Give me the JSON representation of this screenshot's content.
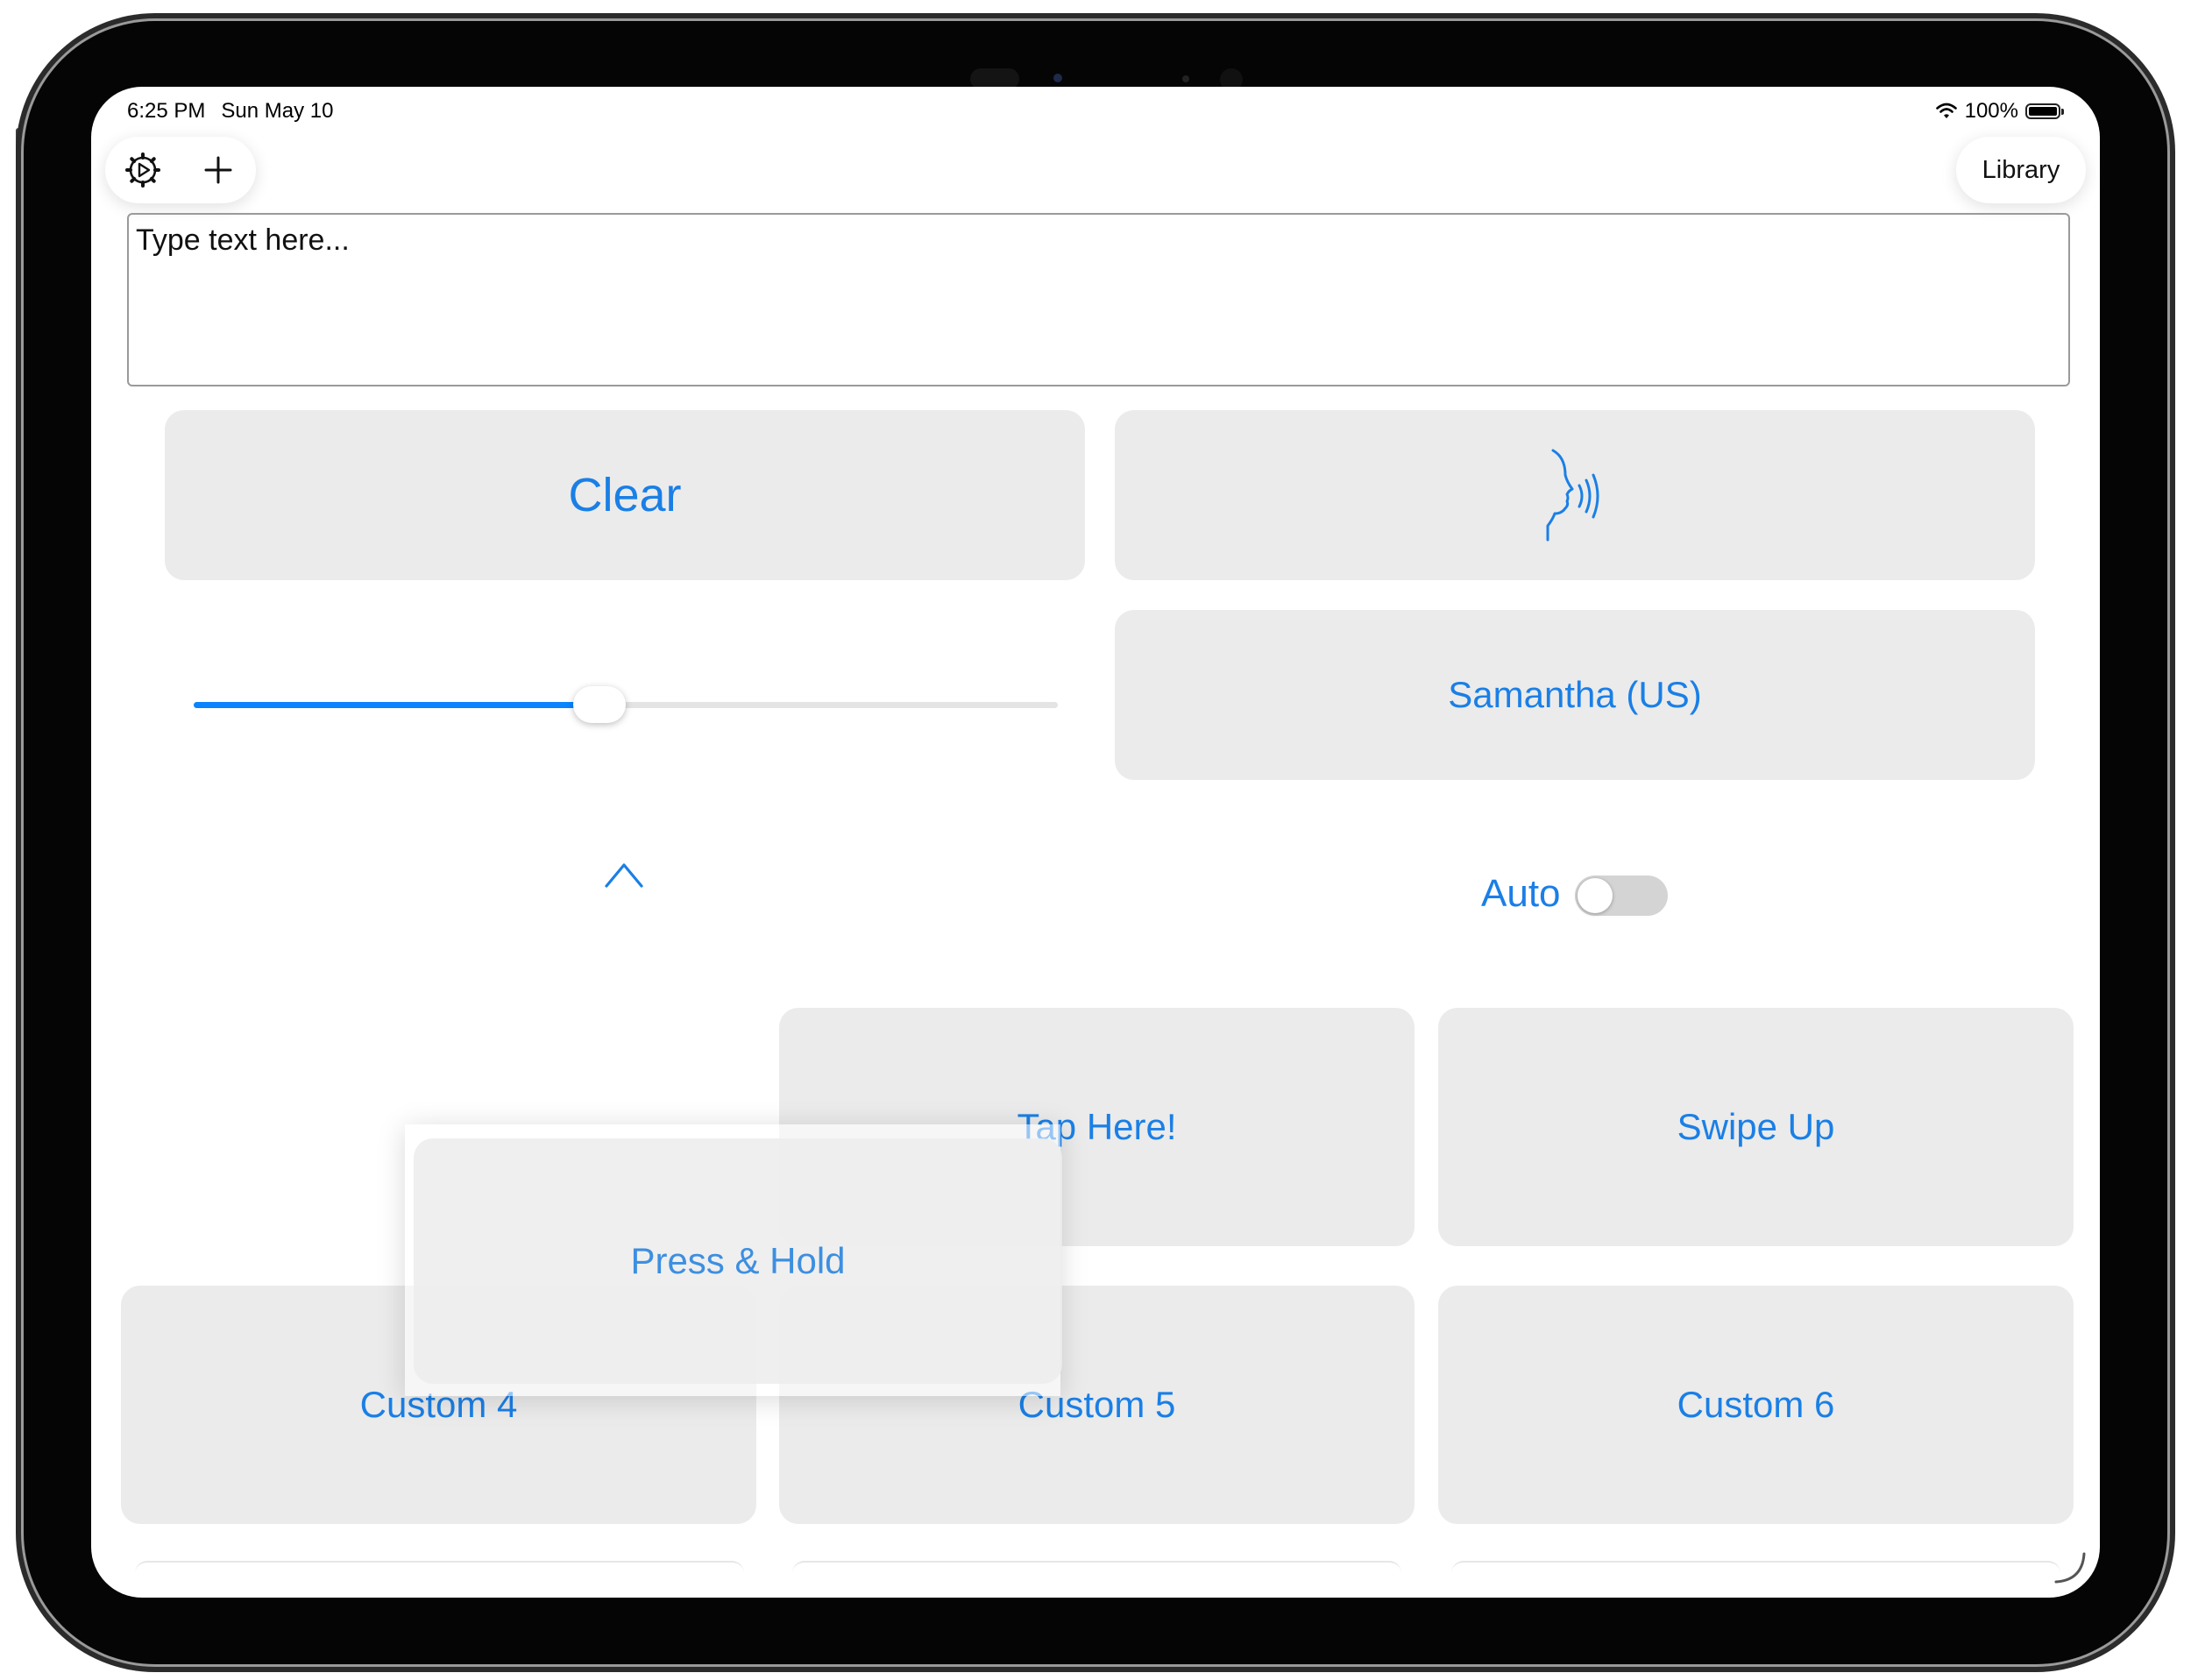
{
  "status_bar": {
    "time": "6:25 PM",
    "date": "Sun May 10",
    "battery": "100%"
  },
  "toolbar": {
    "settings_icon": "gear-icon",
    "add_icon": "plus-icon",
    "library_label": "Library"
  },
  "text_input": {
    "placeholder": "Type text here..."
  },
  "controls": {
    "clear_label": "Clear",
    "speak_icon": "speaking-head-icon",
    "voice_label": "Samantha (US)",
    "rate_slider_value": 0.47,
    "auto_label": "Auto",
    "auto_on": false,
    "collapse_icon": "chevron-up-icon"
  },
  "phrase_buttons": [
    {
      "label": "Tap Here!"
    },
    {
      "label": "Swipe Up"
    },
    {
      "label": "Custom 4"
    },
    {
      "label": "Custom 5"
    },
    {
      "label": "Custom 6"
    }
  ],
  "drag_preview": {
    "label": "Press & Hold"
  },
  "colors": {
    "accent": "#1a7fe6",
    "button_bg": "#ebebeb",
    "slider_fill": "#0a84ff"
  }
}
